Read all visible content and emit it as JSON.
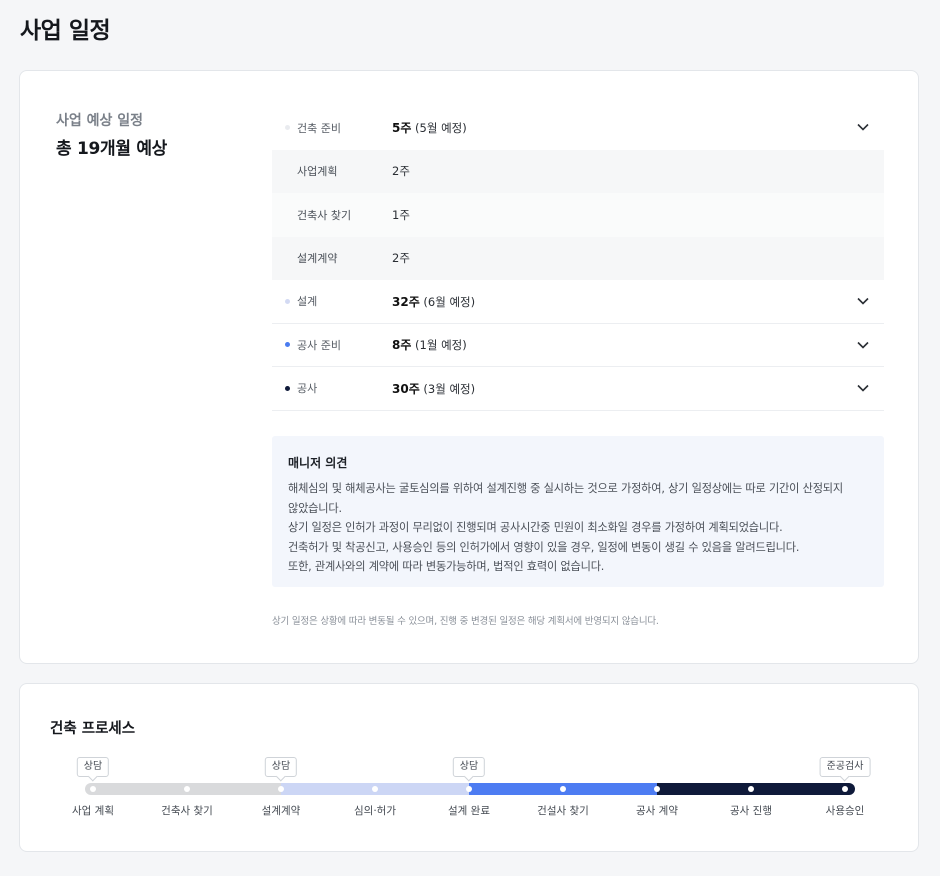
{
  "page": {
    "title": "사업 일정"
  },
  "summary": {
    "subtitle": "사업 예상 일정",
    "total": "총 19개월 예상"
  },
  "phases": [
    {
      "label": "건축 준비",
      "weeks": "5주",
      "note": "(5월 예정)",
      "dot_color": "#e9ebef",
      "expanded": true,
      "subs": [
        {
          "label": "사업계획",
          "weeks": "2주"
        },
        {
          "label": "건축사 찾기",
          "weeks": "1주"
        },
        {
          "label": "설계계약",
          "weeks": "2주"
        }
      ]
    },
    {
      "label": "설계",
      "weeks": "32주",
      "note": "(6월 예정)",
      "dot_color": "#d3daf3",
      "expanded": false
    },
    {
      "label": "공사 준비",
      "weeks": "8주",
      "note": "(1월 예정)",
      "dot_color": "#4a7cf0",
      "expanded": false
    },
    {
      "label": "공사",
      "weeks": "30주",
      "note": "(3월 예정)",
      "dot_color": "#0f1a3a",
      "expanded": false
    }
  ],
  "opinion": {
    "title": "매니저 의견",
    "text": "해체심의 및 해체공사는 굴토심의를 위하여 설계진행 중 실시하는 것으로 가정하여, 상기 일정상에는 따로 기간이 산정되지\n않았습니다.\n상기 일정은 인허가 과정이 무리없이 진행되며 공사시간중 민원이 최소화일 경우를 가정하여 계획되었습니다.\n건축허가 및 착공신고, 사용승인 등의 인허가에서 영향이 있을 경우, 일정에 변동이 생길 수 있음을 알려드립니다.\n또한, 관계사와의 계약에 따라 변동가능하며, 법적인 효력이 없습니다."
  },
  "footnote": "상기 일정은 상황에 따라 변동될 수 있으며, 진행 중 변경된 일정은 해당 계획서에 반영되지 않습니다.",
  "process": {
    "title": "건축 프로세스",
    "steps": [
      "사업 계획",
      "건축사 찾기",
      "설계계약",
      "심의·허가",
      "설계 완료",
      "건설사 찾기",
      "공사 계약",
      "공사 진행",
      "사용승인"
    ],
    "tags": [
      {
        "label": "상담",
        "step": 0
      },
      {
        "label": "상담",
        "step": 2
      },
      {
        "label": "상담",
        "step": 4
      },
      {
        "label": "준공검사",
        "step": 8
      }
    ],
    "segment_colors": [
      "#d9dadc",
      "#ccd6f5",
      "#4d7cf2",
      "#0f1a3a"
    ]
  }
}
